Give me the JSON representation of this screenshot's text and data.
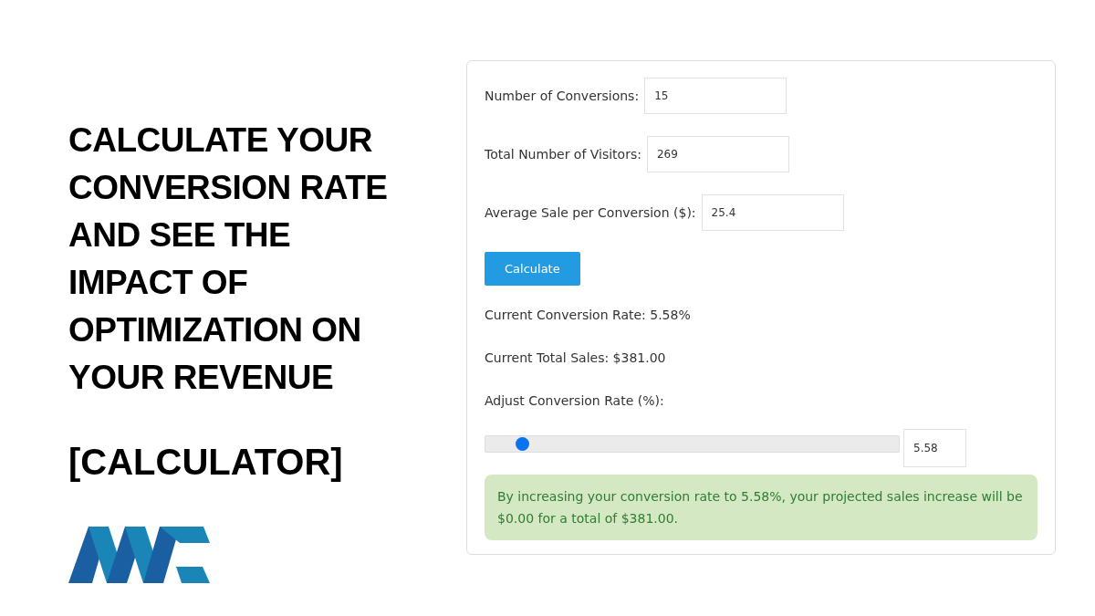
{
  "heading": "CALCULATE YOUR CONVERSION RATE AND SEE THE IMPACT OF OPTIMIZATION ON YOUR REVENUE",
  "subheading": "[CALCULATOR]",
  "fields": [
    {
      "label": "Number of Conversions:",
      "value": "15"
    },
    {
      "label": "Total Number of Visitors:",
      "value": "269"
    },
    {
      "label": "Average Sale per Conversion ($):",
      "value": "25.4"
    }
  ],
  "button": "Calculate",
  "results": [
    "Current Conversion Rate: 5.58%",
    "Current Total Sales: $381.00"
  ],
  "slider": {
    "label": "Adjust Conversion Rate (%):",
    "level": 0.09,
    "value": "5.58"
  },
  "message": "By increasing your conversion rate to 5.58%, your projected sales increase will be $0.00 for a total of $381.00."
}
